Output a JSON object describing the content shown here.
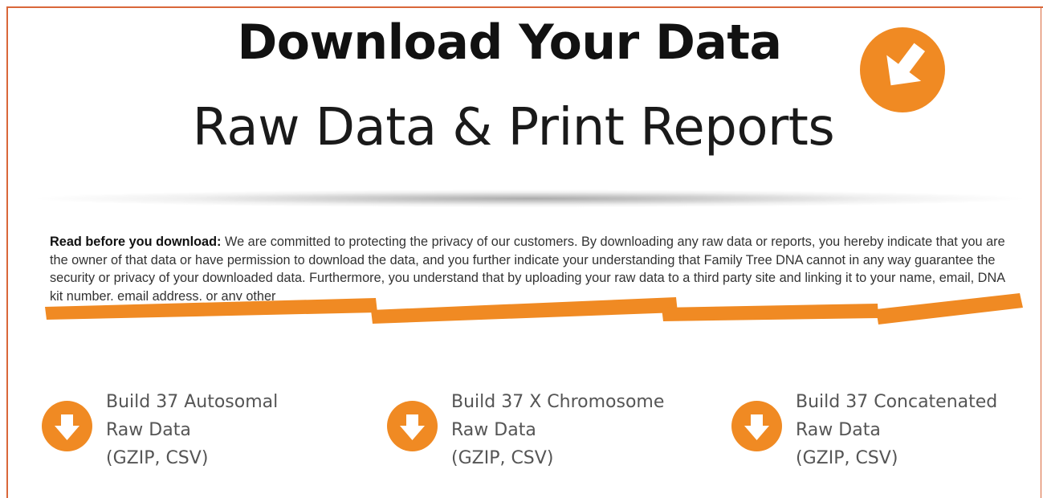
{
  "header": {
    "title": "Download Your Data",
    "subtitle": "Raw Data & Print Reports",
    "icon": "download-arrow-icon"
  },
  "notice": {
    "lead": "Read before you download:",
    "body": " We are committed to protecting the privacy of our customers. By downloading any raw data or reports, you hereby indicate that you are the owner of that data or have permission to download the data, and you further indicate your understanding that Family Tree DNA cannot in any way guarantee the security or privacy of your downloaded data. Furthermore, you understand that by uploading your raw data to a third party site and linking it to your name, email, DNA kit number, email address, or any other"
  },
  "downloads": [
    {
      "line1": "Build 37 Autosomal",
      "line2": "Raw Data",
      "line3": "(GZIP, CSV)",
      "icon": "download-circle-icon"
    },
    {
      "line1": "Build 37 X Chromosome",
      "line2": "Raw Data",
      "line3": "(GZIP, CSV)",
      "icon": "download-circle-icon"
    },
    {
      "line1": "Build 37 Concatenated",
      "line2": "Raw Data",
      "line3": "(GZIP, CSV)",
      "icon": "download-circle-icon"
    }
  ],
  "colors": {
    "accent": "#f08a23",
    "border": "#d9673a",
    "text": "#333333"
  }
}
